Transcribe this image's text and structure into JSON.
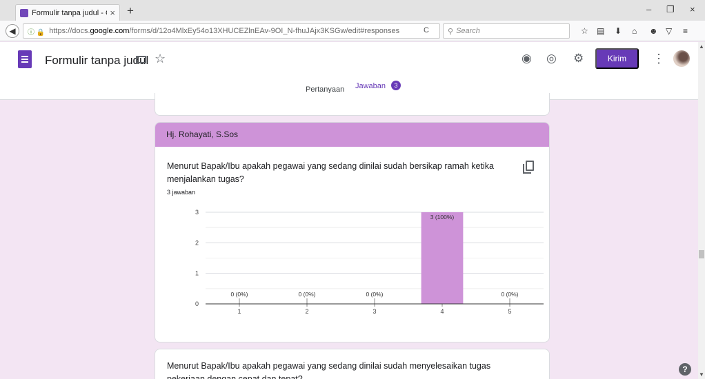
{
  "browser": {
    "tab_title": "Formulir tanpa judul - Go...",
    "tab_close": "×",
    "new_tab": "+",
    "url_prefix": "https://docs.",
    "url_domain": "google.com",
    "url_rest": "/forms/d/12o4MlxEy54o13XHUCEZlnEAv-9OI_N-fhuJAjx3KSGw/edit#responses",
    "search_placeholder": "Search",
    "minimize": "–",
    "restore": "❐",
    "close": "×"
  },
  "form": {
    "title": "Formulir tanpa judul",
    "send_label": "Kirim",
    "tabs": [
      {
        "label": "Pertanyaan"
      },
      {
        "label": "Jawaban",
        "badge": "3"
      }
    ]
  },
  "response_card": {
    "respondent": "Hj. Rohayati, S.Sos",
    "question": "Menurut Bapak/Ibu apakah pegawai yang sedang dinilai sudah bersikap ramah ketika menjalankan tugas?",
    "response_count": "3 jawaban"
  },
  "next_card": {
    "question": "Menurut Bapak/Ibu apakah pegawai yang sedang dinilai sudah menyelesaikan tugas pekerjaan dengan cepat dan tepat?"
  },
  "help_label": "?",
  "colors": {
    "accent": "#673ab7",
    "bar": "#ce93d8",
    "background": "#f3e5f3"
  },
  "chart_data": {
    "type": "bar",
    "categories": [
      "1",
      "2",
      "3",
      "4",
      "5"
    ],
    "values": [
      0,
      0,
      0,
      3,
      0
    ],
    "data_labels": [
      "0 (0%)",
      "0 (0%)",
      "0 (0%)",
      "3 (100%)",
      "0 (0%)"
    ],
    "y_ticks": [
      0,
      1,
      2,
      3
    ],
    "ylim": [
      0,
      3
    ],
    "grid": true,
    "title": "",
    "xlabel": "",
    "ylabel": ""
  }
}
